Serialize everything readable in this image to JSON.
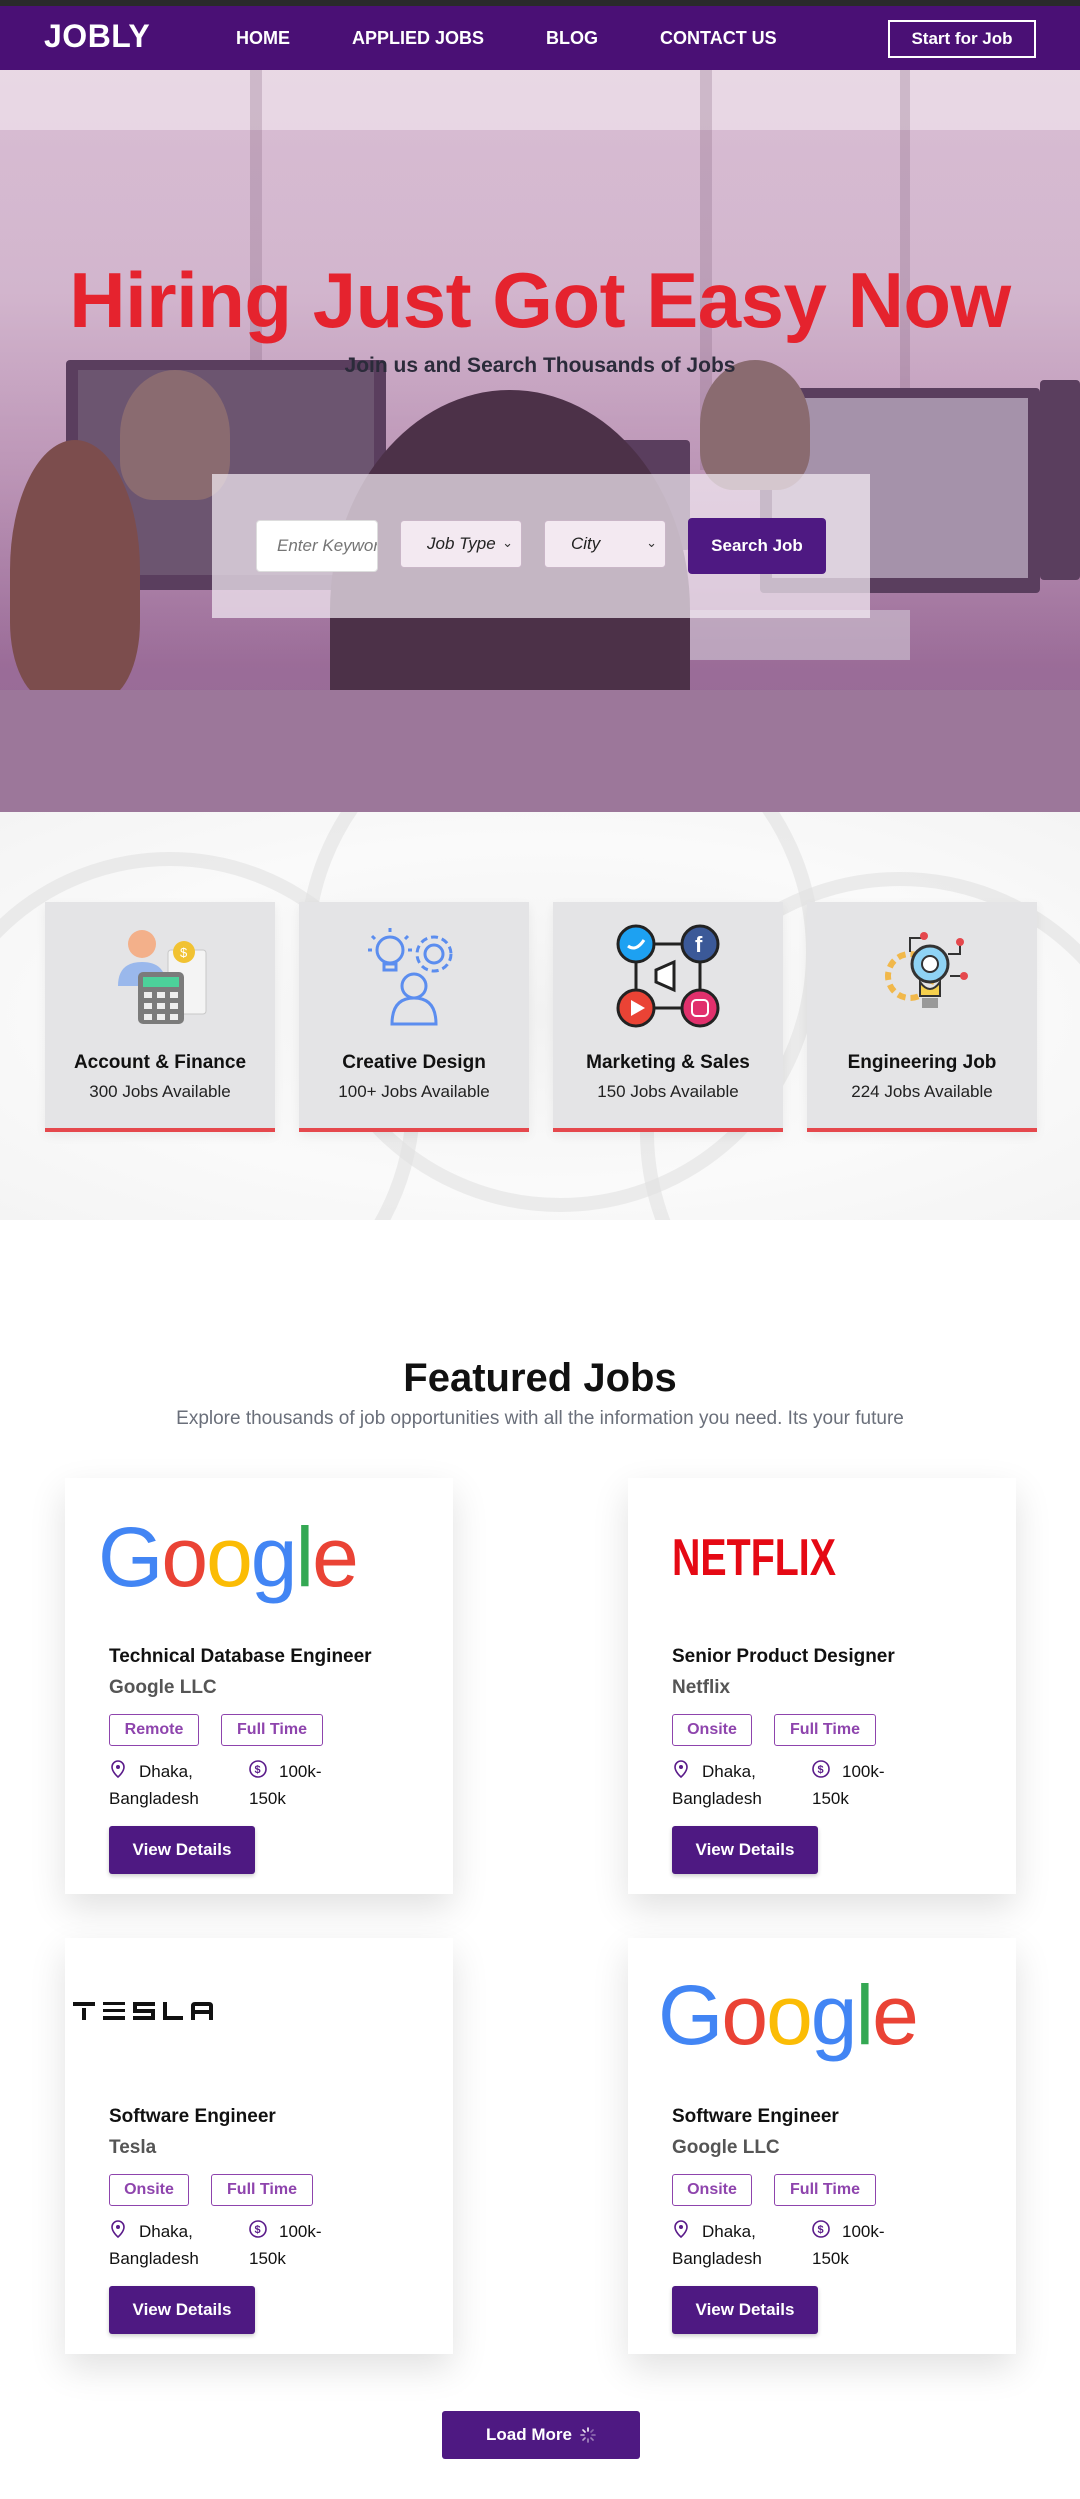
{
  "nav": {
    "logo": "JOBLY",
    "links": [
      "HOME",
      "APPLIED JOBS",
      "BLOG",
      "CONTACT US"
    ],
    "cta": "Start for Job"
  },
  "hero": {
    "title": "Hiring Just Got Easy Now",
    "subtitle": "Join us and Search Thousands of Jobs",
    "search": {
      "keyword_placeholder": "Enter Keyword",
      "job_type_selected": "Job Type",
      "city_selected": "City",
      "button": "Search Job"
    }
  },
  "categories": [
    {
      "name": "Account & Finance",
      "count": "300 Jobs Available",
      "icon": "finance-icon"
    },
    {
      "name": "Creative Design",
      "count": "100+ Jobs Available",
      "icon": "creative-design-icon"
    },
    {
      "name": "Marketing & Sales",
      "count": "150 Jobs Available",
      "icon": "marketing-social-icon"
    },
    {
      "name": "Engineering Job",
      "count": "224 Jobs Available",
      "icon": "engineering-icon"
    }
  ],
  "featured": {
    "title": "Featured Jobs",
    "subtitle": "Explore thousands of job opportunities with all the information you need. Its your future",
    "jobs": [
      {
        "title": "Technical Database Engineer",
        "company": "Google LLC",
        "logo": "Google",
        "type": "Remote",
        "time": "Full Time",
        "location": "Dhaka, Bangladesh",
        "salary": "100k-150k",
        "button": "View Details"
      },
      {
        "title": "Senior Product Designer",
        "company": "Netflix",
        "logo": "NETFLIX",
        "type": "Onsite",
        "time": "Full Time",
        "location": "Dhaka, Bangladesh",
        "salary": "100k-150k",
        "button": "View Details"
      },
      {
        "title": "Software Engineer",
        "company": "Tesla",
        "logo": "TESLA",
        "type": "Onsite",
        "time": "Full Time",
        "location": "Dhaka, Bangladesh",
        "salary": "100k-150k",
        "button": "View Details"
      },
      {
        "title": "Software Engineer",
        "company": "Google LLC",
        "logo": "Google",
        "type": "Onsite",
        "time": "Full Time",
        "location": "Dhaka, Bangladesh",
        "salary": "100k-150k",
        "button": "View Details"
      }
    ],
    "load_more": "Load More"
  },
  "colors": {
    "nav_bg": "#4a1075",
    "primary_button": "#4e1982",
    "hero_title": "#e5232e",
    "category_underline": "#e5484d",
    "tag": "#8e44ad"
  }
}
